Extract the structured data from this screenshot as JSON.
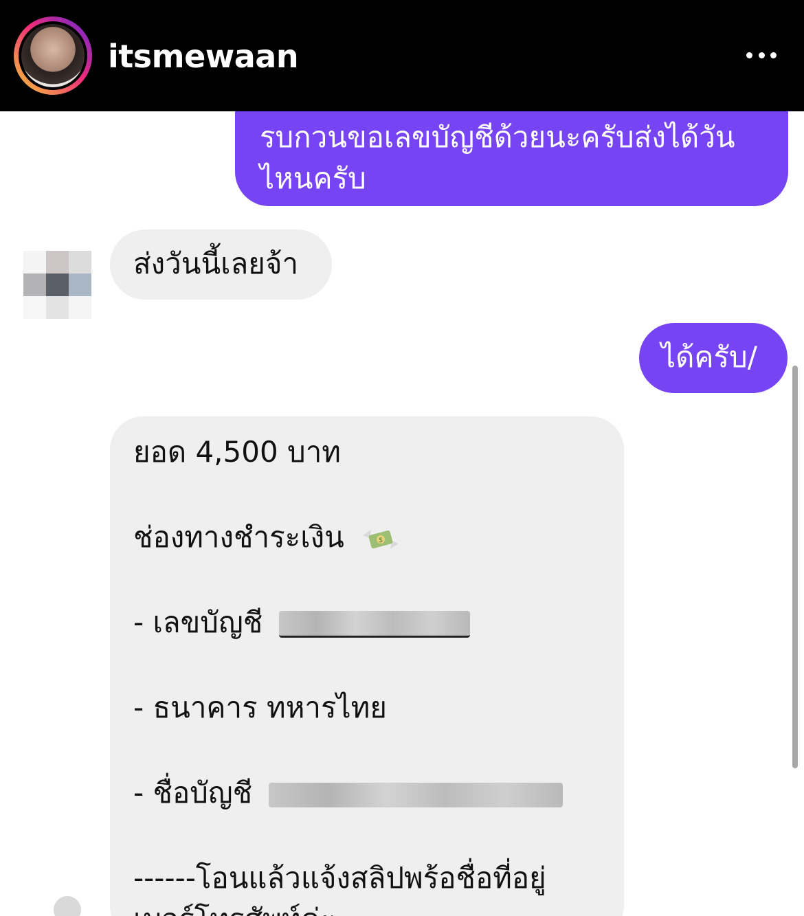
{
  "header": {
    "username": "itsmewaan",
    "more_icon": "more-horizontal-icon"
  },
  "messages": [
    {
      "from": "me",
      "text": "รบกวนขอเลขบัญชีด้วยนะครับส่งได้วันไหนครับ"
    },
    {
      "from": "other",
      "text": "ส่งวันนี้เลยจ้า"
    },
    {
      "from": "me",
      "text": "ได้ครับ/"
    },
    {
      "from": "other",
      "lines": {
        "amount": "ยอด 4,500 บาท",
        "payment_channel": "ช่องทางชำระเงิน",
        "account_number_label": "- เลขบัญชี",
        "bank": "- ธนาคาร ทหารไทย",
        "account_name_label": "- ชื่อบัญชี",
        "instruction": "------โอนแล้วแจ้งสลิปพร้อชื่อที่อยู่",
        "instruction_2": "เบอร์โทรศัพท์ค่ะ"
      }
    }
  ],
  "icons": {
    "money_icon": "money-with-wings-icon"
  },
  "colors": {
    "outgoing_bubble": "#7744f3",
    "incoming_bubble": "#efefef",
    "header_bg": "#000000"
  }
}
